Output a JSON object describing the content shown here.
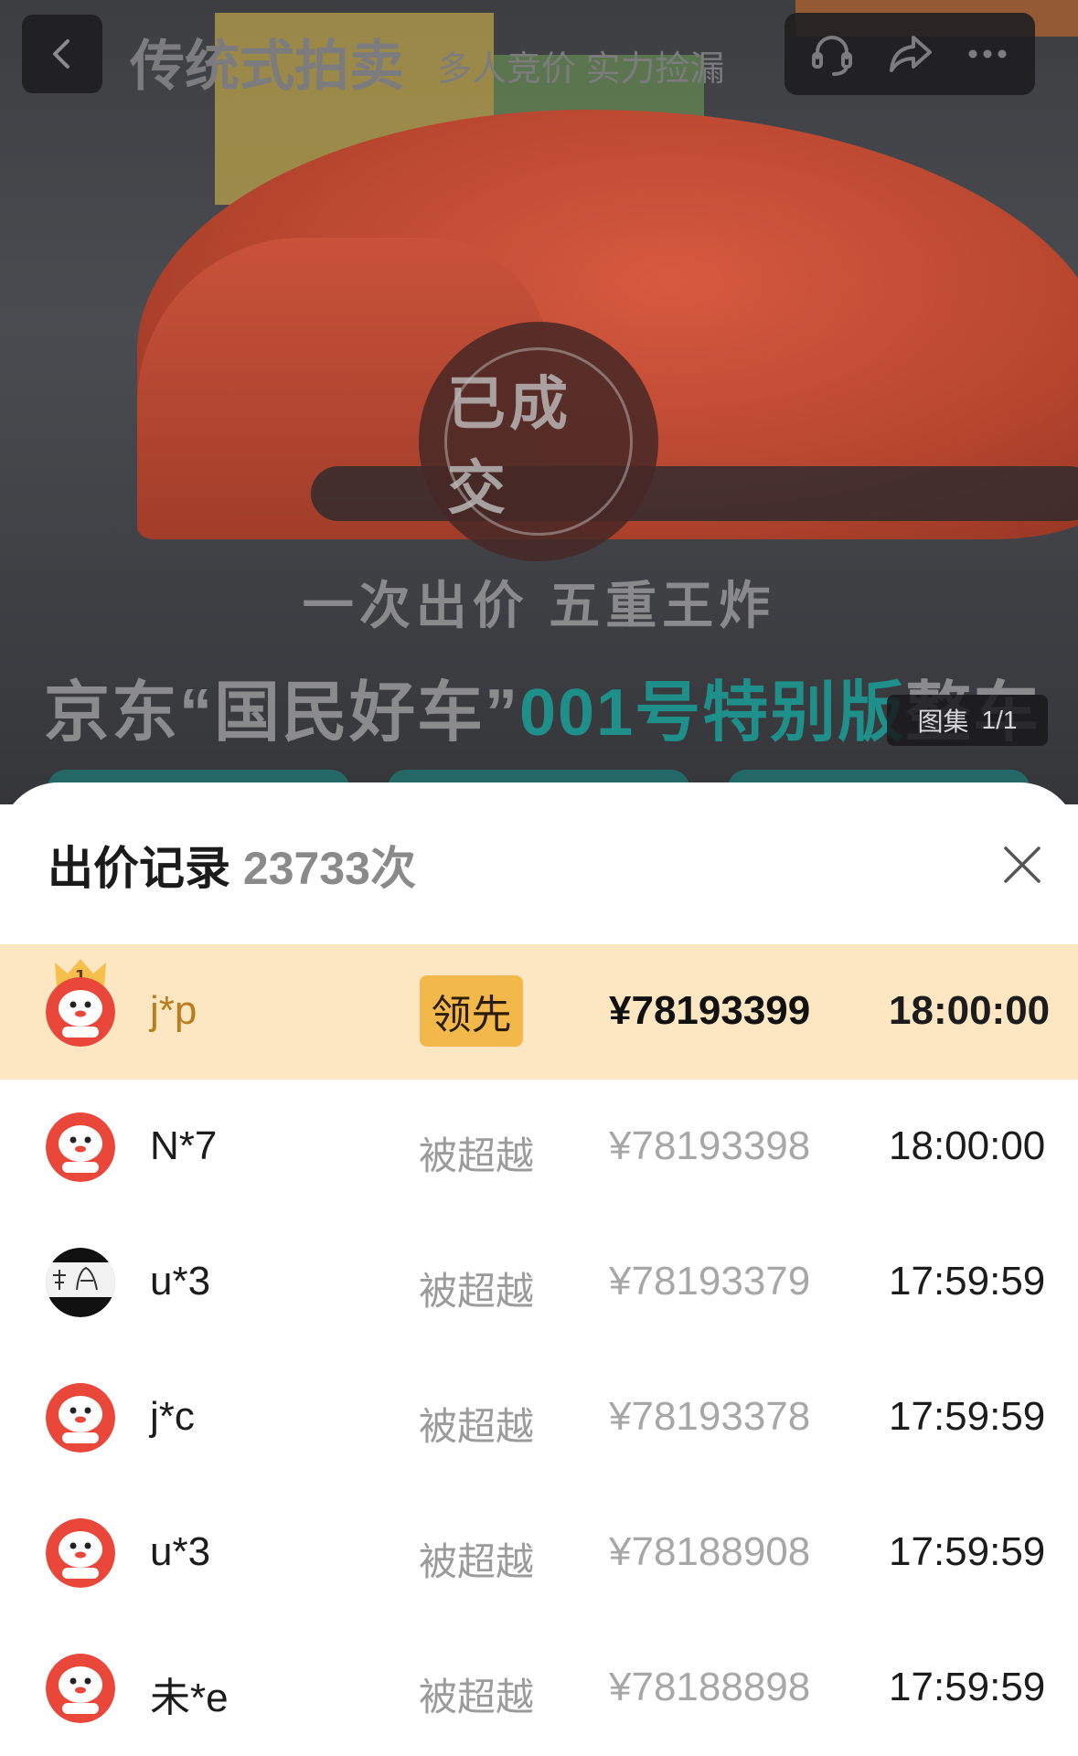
{
  "header": {
    "title": "传统式拍卖",
    "subtitle": "多人竞价 实力捡漏"
  },
  "hero": {
    "stamp_text": "已成交",
    "slogan": "一次出价 五重王炸",
    "headline_prefix": "京东“国民好车”",
    "headline_accent": "001号特别版",
    "headline_suffix": "整车",
    "gallery_label": "图集",
    "gallery_index": "1/1"
  },
  "sheet": {
    "title": "出价记录",
    "count": "23733次"
  },
  "bids": [
    {
      "user": "j*p",
      "status": "领先",
      "price": "¥78193399",
      "time": "18:00:00",
      "avatar": "jd-mascot-icon",
      "leading": true
    },
    {
      "user": "N*7",
      "status": "被超越",
      "price": "¥78193398",
      "time": "18:00:00",
      "avatar": "jd-mascot-icon",
      "leading": false
    },
    {
      "user": "u*3",
      "status": "被超越",
      "price": "¥78193379",
      "time": "17:59:59",
      "avatar": "handwriting-avatar",
      "leading": false
    },
    {
      "user": "j*c",
      "status": "被超越",
      "price": "¥78193378",
      "time": "17:59:59",
      "avatar": "jd-mascot-icon",
      "leading": false
    },
    {
      "user": "u*3",
      "status": "被超越",
      "price": "¥78188908",
      "time": "17:59:59",
      "avatar": "jd-mascot-icon",
      "leading": false
    },
    {
      "user": "未*e",
      "status": "被超越",
      "price": "¥78188898",
      "time": "17:59:59",
      "avatar": "jd-mascot-icon",
      "leading": false
    }
  ],
  "colors": {
    "lead_row_bg": "#fde7c3",
    "lead_badge": "#f2b84a",
    "lead_name": "#b97d1e",
    "accent_teal": "#1f8f8a"
  }
}
